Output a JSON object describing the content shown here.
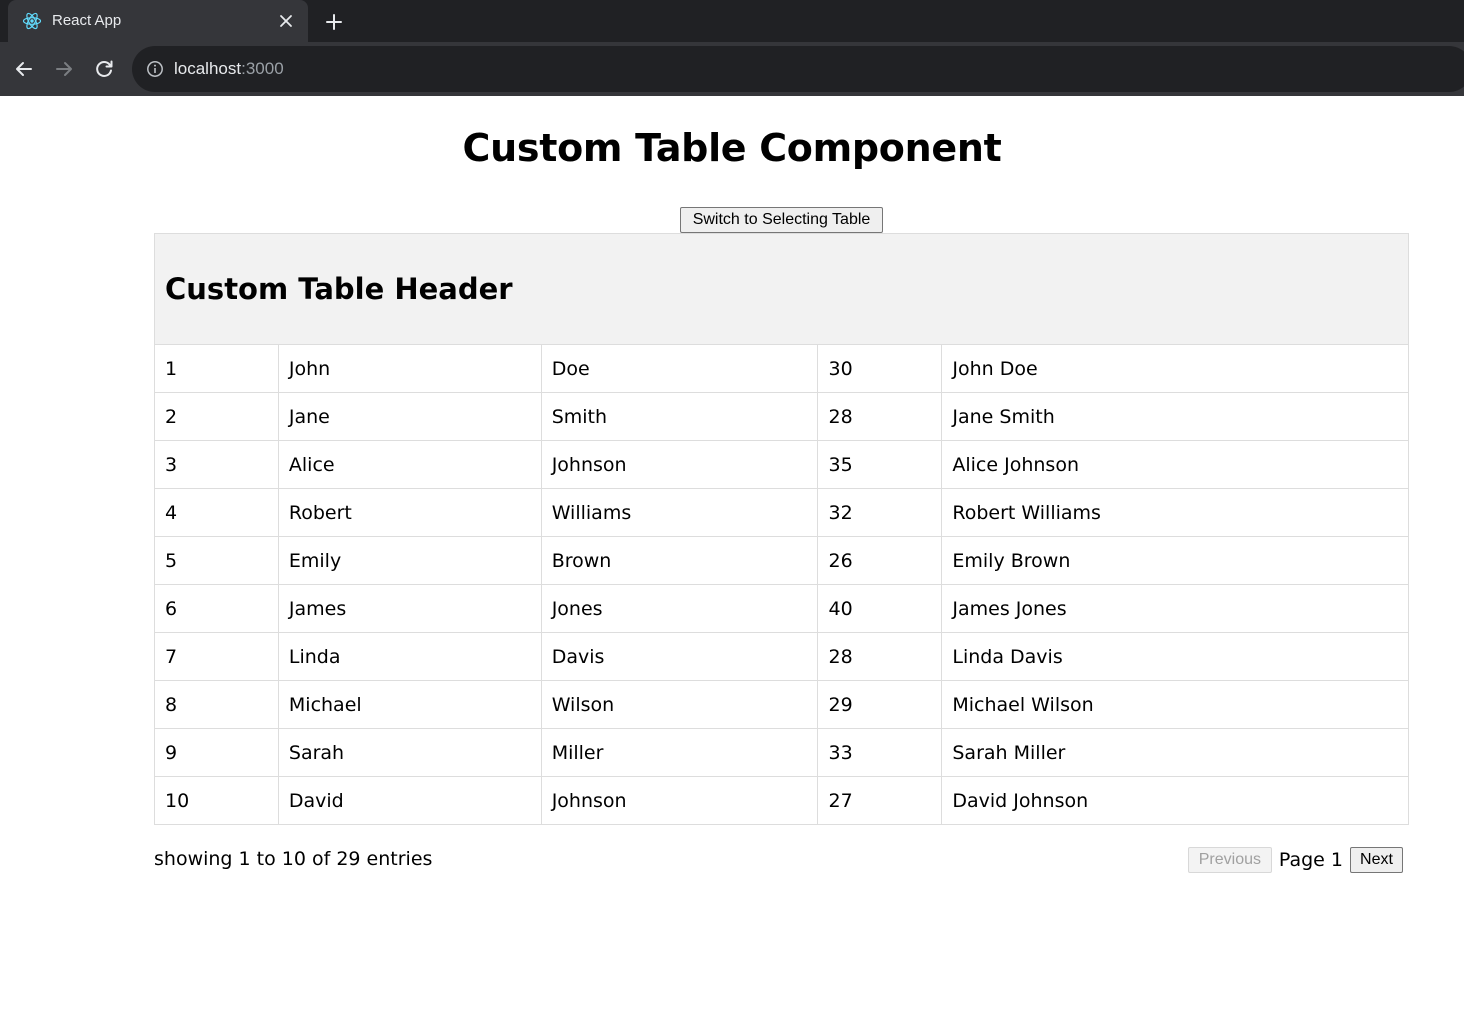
{
  "browser": {
    "tab_title": "React App",
    "url_host": "localhost",
    "url_port": ":3000",
    "icons": {
      "favicon": "react-logo-icon",
      "close": "close-icon",
      "new_tab": "plus-icon",
      "back": "arrow-left-icon",
      "forward": "arrow-right-icon",
      "reload": "reload-icon",
      "info": "info-icon"
    }
  },
  "page": {
    "title": "Custom Table Component",
    "switch_button_label": "Switch to Selecting Table"
  },
  "table": {
    "header_title": "Custom Table Header",
    "rows": [
      [
        "1",
        "John",
        "Doe",
        "30",
        "John Doe"
      ],
      [
        "2",
        "Jane",
        "Smith",
        "28",
        "Jane Smith"
      ],
      [
        "3",
        "Alice",
        "Johnson",
        "35",
        "Alice Johnson"
      ],
      [
        "4",
        "Robert",
        "Williams",
        "32",
        "Robert Williams"
      ],
      [
        "5",
        "Emily",
        "Brown",
        "26",
        "Emily Brown"
      ],
      [
        "6",
        "James",
        "Jones",
        "40",
        "James Jones"
      ],
      [
        "7",
        "Linda",
        "Davis",
        "28",
        "Linda Davis"
      ],
      [
        "8",
        "Michael",
        "Wilson",
        "29",
        "Michael Wilson"
      ],
      [
        "9",
        "Sarah",
        "Miller",
        "33",
        "Sarah Miller"
      ],
      [
        "10",
        "David",
        "Johnson",
        "27",
        "David Johnson"
      ]
    ]
  },
  "footer": {
    "showing_text": "showing 1 to 10 of 29 entries",
    "previous_label": "Previous",
    "page_label": "Page 1",
    "next_label": "Next"
  },
  "colors": {
    "chrome_dark": "#202124",
    "chrome_tab": "#35363a",
    "header_bg": "#f2f2f2",
    "border": "#dddddd",
    "react_blue": "#61dafb"
  }
}
